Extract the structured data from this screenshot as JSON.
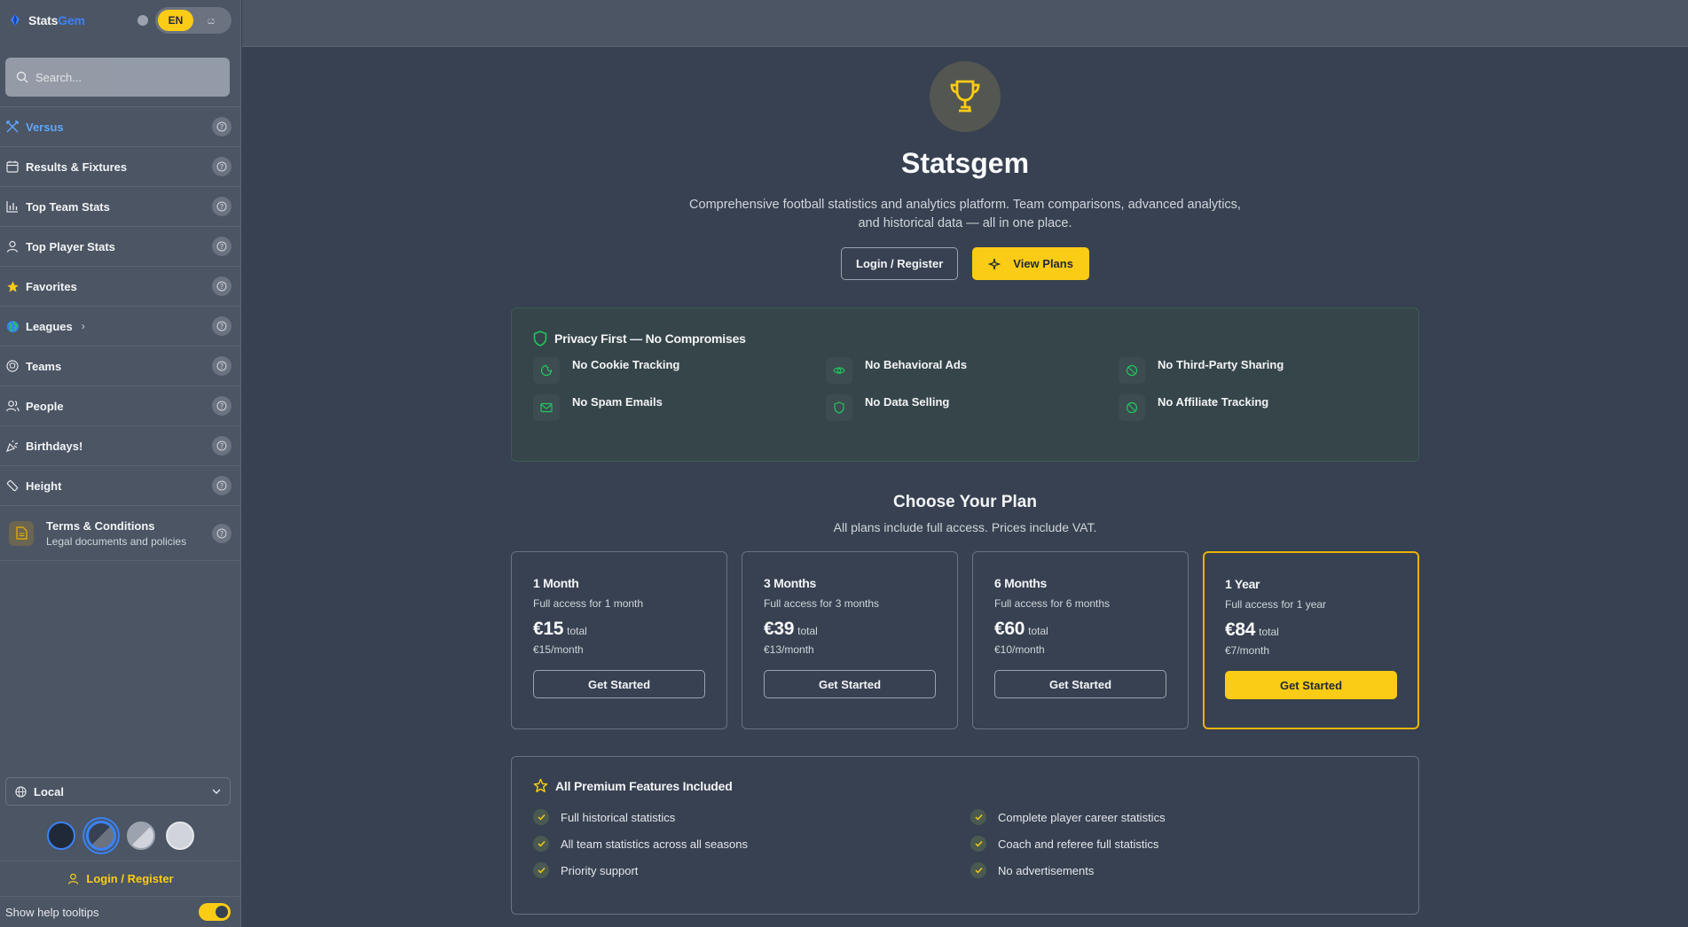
{
  "brand": {
    "part1": "Stats",
    "part2": "Gem"
  },
  "lang": {
    "active": "EN",
    "other": "ය"
  },
  "search": {
    "placeholder": "Search..."
  },
  "nav": [
    {
      "label": "Versus",
      "icon": "swords-icon",
      "active": true
    },
    {
      "label": "Results & Fixtures",
      "icon": "calendar-icon"
    },
    {
      "label": "Top Team Stats",
      "icon": "bar-chart-icon"
    },
    {
      "label": "Top Player Stats",
      "icon": "user-icon"
    },
    {
      "label": "Favorites",
      "icon": "star-icon"
    },
    {
      "label": "Leagues",
      "icon": "globe-icon",
      "chevron": "›"
    },
    {
      "label": "Teams",
      "icon": "shield-icon"
    },
    {
      "label": "People",
      "icon": "users-icon"
    },
    {
      "label": "Birthdays!",
      "icon": "party-icon"
    },
    {
      "label": "Height",
      "icon": "ruler-icon"
    }
  ],
  "terms": {
    "title": "Terms & Conditions",
    "subtitle": "Legal documents and policies"
  },
  "timezone": {
    "value": "Local"
  },
  "sidebar_login": "Login / Register",
  "tooltips": {
    "label": "Show help tooltips",
    "enabled": true
  },
  "hero": {
    "title": "Statsgem",
    "description": "Comprehensive football statistics and analytics platform. Team comparisons, advanced analytics, and historical data — all in one place.",
    "login_label": "Login / Register",
    "plans_label": "View Plans"
  },
  "privacy": {
    "title": "Privacy First — No Compromises",
    "items": [
      {
        "label": "No Cookie Tracking",
        "icon": "cookie-icon"
      },
      {
        "label": "No Behavioral Ads",
        "icon": "eye-icon"
      },
      {
        "label": "No Third-Party Sharing",
        "icon": "ban-icon"
      },
      {
        "label": "No Spam Emails",
        "icon": "mail-icon"
      },
      {
        "label": "No Data Selling",
        "icon": "shield-icon"
      },
      {
        "label": "No Affiliate Tracking",
        "icon": "ban-icon"
      }
    ]
  },
  "plans_section": {
    "title": "Choose Your Plan",
    "subtitle": "All plans include full access. Prices include VAT.",
    "plans": [
      {
        "name": "1 Month",
        "desc": "Full access for 1 month",
        "price": "€15",
        "total": "total",
        "monthly": "€15/month",
        "cta": "Get Started",
        "featured": false
      },
      {
        "name": "3 Months",
        "desc": "Full access for 3 months",
        "price": "€39",
        "total": "total",
        "monthly": "€13/month",
        "cta": "Get Started",
        "featured": false
      },
      {
        "name": "6 Months",
        "desc": "Full access for 6 months",
        "price": "€60",
        "total": "total",
        "monthly": "€10/month",
        "cta": "Get Started",
        "featured": false
      },
      {
        "name": "1 Year",
        "desc": "Full access for 1 year",
        "price": "€84",
        "total": "total",
        "monthly": "€7/month",
        "cta": "Get Started",
        "featured": true
      }
    ]
  },
  "features": {
    "title": "All Premium Features Included",
    "items": [
      "Full historical statistics",
      "Complete player career statistics",
      "All team statistics across all seasons",
      "Coach and referee full statistics",
      "Priority support",
      "No advertisements"
    ]
  },
  "colors": {
    "accent": "#facc15",
    "link": "#60a5fa",
    "privacy_green": "#22c55e"
  }
}
